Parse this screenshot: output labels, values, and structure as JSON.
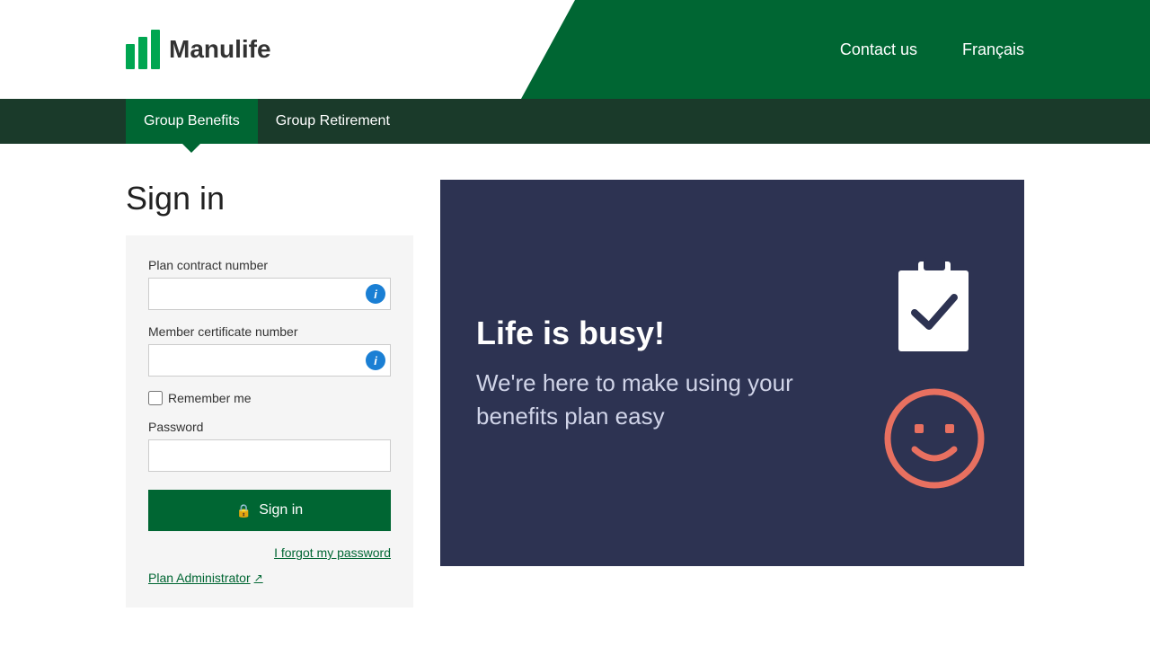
{
  "header": {
    "logo_text": "Manulife",
    "nav": {
      "contact_us": "Contact us",
      "francais": "Français"
    }
  },
  "navbar": {
    "items": [
      {
        "label": "Group Benefits",
        "active": true
      },
      {
        "label": "Group Retirement",
        "active": false
      }
    ]
  },
  "page": {
    "title": "Sign in"
  },
  "form": {
    "plan_contract_label": "Plan contract number",
    "member_cert_label": "Member certificate number",
    "remember_me_label": "Remember me",
    "password_label": "Password",
    "signin_button": "Sign in",
    "forgot_password": "I forgot my password",
    "plan_admin": "Plan Administrator"
  },
  "promo": {
    "headline": "Life is busy!",
    "subtext": "We're here to make using your benefits plan easy"
  },
  "icons": {
    "info": "i",
    "lock": "🔒",
    "external_link": "↗"
  }
}
